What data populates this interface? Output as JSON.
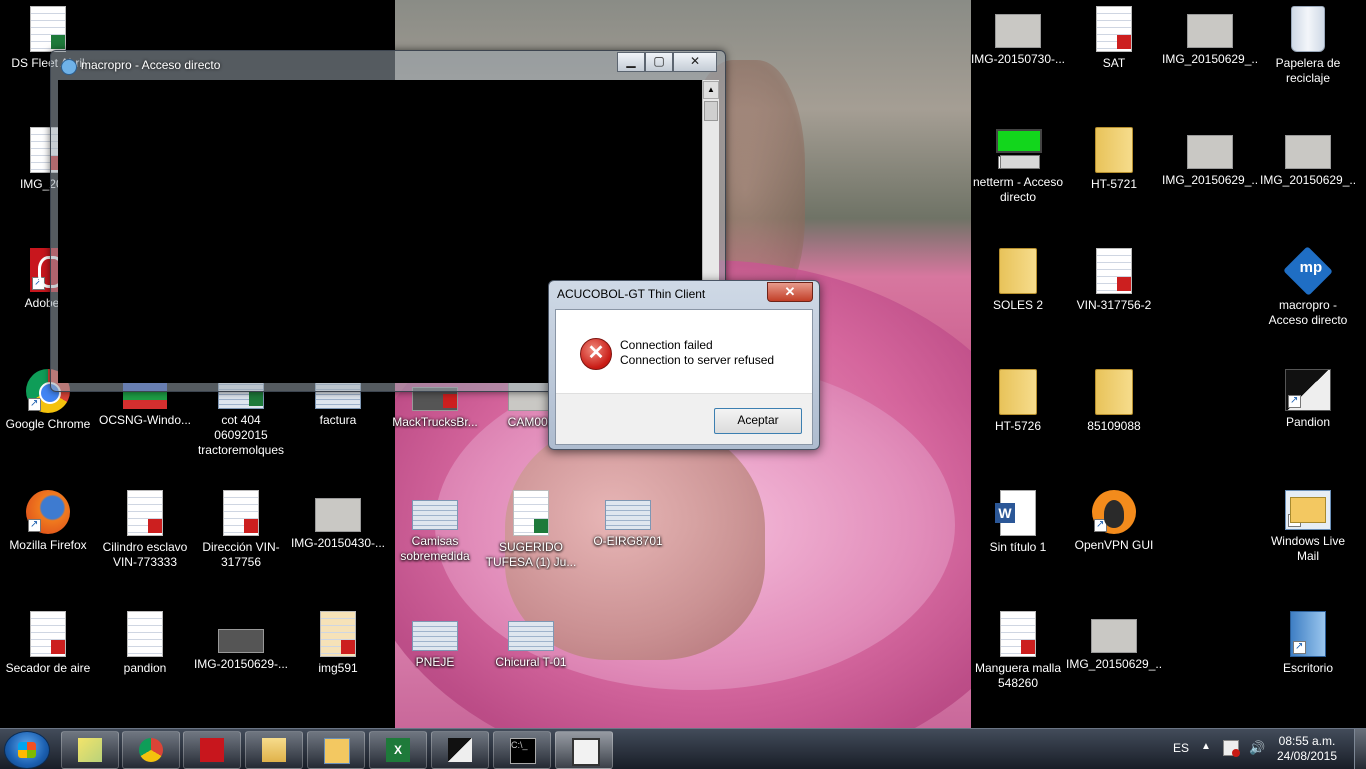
{
  "desktop": {
    "icons": {
      "ds_fleet": "DS Fleet Abril",
      "img_2015": "IMG_2015",
      "adobe_r": "Adobe R",
      "google_chrome": "Google Chrome",
      "ocsng": "OCSNG-Windo...",
      "cot404": "cot 404 06092015 tractoremolques",
      "factura": "factura",
      "macktrucks": "MackTrucksBr...",
      "cam00": "CAM002",
      "firefox": "Mozilla Firefox",
      "cilindro": "Cilindro esclavo VIN-773333",
      "direccion": "Dirección VIN-317756",
      "img_20150430": "IMG-20150430-...",
      "camisas": "Camisas sobremedida",
      "sugerido": "SUGERIDO TUFESA (1) Ju...",
      "o_eirg": "O-EIRG8701",
      "secador": "Secador de aire",
      "pandion_doc": "pandion",
      "img_20150629_dash": "IMG-20150629-...",
      "img591": "img591",
      "pneje": "PNEJE",
      "chicural": "Chicural T-01",
      "img_20150730": "IMG-20150730-...",
      "sat": "SAT",
      "img_20150629_a": "IMG_20150629_...",
      "papelera": "Papelera de reciclaje",
      "netterm": "netterm - Acceso directo",
      "ht5721": "HT-5721",
      "img_20150629_b": "IMG_20150629_...",
      "img_20150629_c": "IMG_20150629_...",
      "soles2": "SOLES 2",
      "vin317756_2": "VIN-317756-2",
      "macropro_sc": "macropro - Acceso directo",
      "ht5726": "HT-5726",
      "n85109088": "85109088",
      "pandion": "Pandion",
      "sin_titulo": "Sin título 1",
      "openvpn": "OpenVPN GUI",
      "windows_live": "Windows Live Mail",
      "manguera": "Manguera malla 548260",
      "img_20150629_d": "IMG_20150629_...",
      "escritorio": "Escritorio"
    }
  },
  "macropro_window": {
    "title": "macropro - Acceso directo",
    "minimize": "▁",
    "maximize": "▢",
    "close": "✕"
  },
  "dialog": {
    "title": "ACUCOBOL-GT Thin Client",
    "close": "✕",
    "line1": "Connection failed",
    "line2": "Connection to server refused",
    "ok_label": "Aceptar",
    "icon": "error-icon"
  },
  "taskbar": {
    "language": "ES",
    "time": "08:55 a.m.",
    "date": "24/08/2015",
    "pinned": [
      "explorer-sticky-notes",
      "chrome",
      "acrobat",
      "windows-explorer",
      "outlook-express",
      "excel",
      "pandion",
      "cmd",
      "multi-window"
    ]
  }
}
